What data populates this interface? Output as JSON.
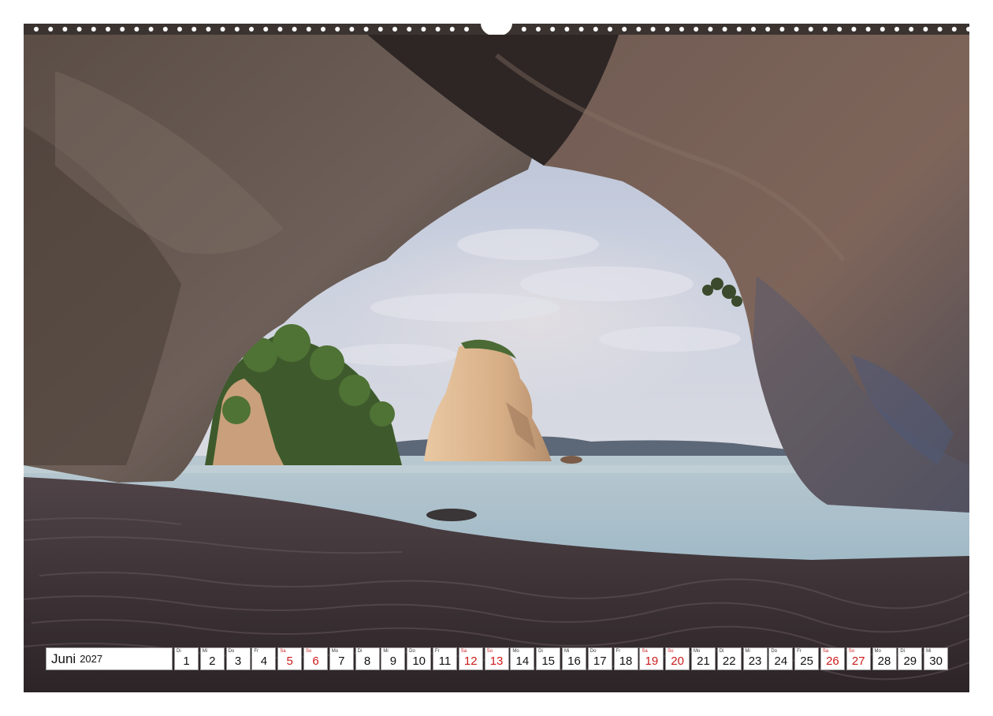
{
  "calendar": {
    "month": "Juni",
    "year": "2027",
    "weekend_color": "#cc1b1b",
    "days": [
      {
        "abbr": "Di",
        "num": "1",
        "weekend": false
      },
      {
        "abbr": "Mi",
        "num": "2",
        "weekend": false
      },
      {
        "abbr": "Do",
        "num": "3",
        "weekend": false
      },
      {
        "abbr": "Fr",
        "num": "4",
        "weekend": false
      },
      {
        "abbr": "Sa",
        "num": "5",
        "weekend": true
      },
      {
        "abbr": "So",
        "num": "6",
        "weekend": true
      },
      {
        "abbr": "Mo",
        "num": "7",
        "weekend": false
      },
      {
        "abbr": "Di",
        "num": "8",
        "weekend": false
      },
      {
        "abbr": "Mi",
        "num": "9",
        "weekend": false
      },
      {
        "abbr": "Do",
        "num": "10",
        "weekend": false
      },
      {
        "abbr": "Fr",
        "num": "11",
        "weekend": false
      },
      {
        "abbr": "Sa",
        "num": "12",
        "weekend": true
      },
      {
        "abbr": "So",
        "num": "13",
        "weekend": true
      },
      {
        "abbr": "Mo",
        "num": "14",
        "weekend": false
      },
      {
        "abbr": "Di",
        "num": "15",
        "weekend": false
      },
      {
        "abbr": "Mi",
        "num": "16",
        "weekend": false
      },
      {
        "abbr": "Do",
        "num": "17",
        "weekend": false
      },
      {
        "abbr": "Fr",
        "num": "18",
        "weekend": false
      },
      {
        "abbr": "Sa",
        "num": "19",
        "weekend": true
      },
      {
        "abbr": "So",
        "num": "20",
        "weekend": true
      },
      {
        "abbr": "Mo",
        "num": "21",
        "weekend": false
      },
      {
        "abbr": "Di",
        "num": "22",
        "weekend": false
      },
      {
        "abbr": "Mi",
        "num": "23",
        "weekend": false
      },
      {
        "abbr": "Do",
        "num": "24",
        "weekend": false
      },
      {
        "abbr": "Fr",
        "num": "25",
        "weekend": false
      },
      {
        "abbr": "Sa",
        "num": "26",
        "weekend": true
      },
      {
        "abbr": "So",
        "num": "27",
        "weekend": true
      },
      {
        "abbr": "Mo",
        "num": "28",
        "weekend": false
      },
      {
        "abbr": "Di",
        "num": "29",
        "weekend": false
      },
      {
        "abbr": "Mi",
        "num": "30",
        "weekend": false
      }
    ]
  }
}
